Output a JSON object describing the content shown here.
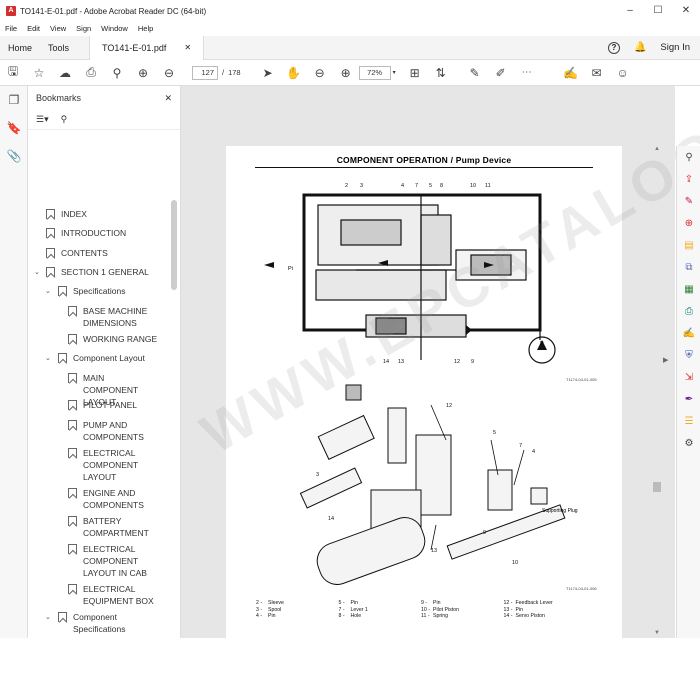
{
  "window": {
    "title": "TO141-E-01.pdf - Adobe Acrobat Reader DC (64-bit)",
    "controls": [
      "–",
      "☐",
      "✕"
    ]
  },
  "menu": [
    "File",
    "Edit",
    "View",
    "Sign",
    "Window",
    "Help"
  ],
  "tabs": {
    "home": "Home",
    "tools": "Tools",
    "doc": "TO141-E-01.pdf",
    "doc_close": "✕",
    "signin": "Sign In"
  },
  "toolbar": {
    "page_current": "127",
    "page_sep": "/",
    "page_total": "178",
    "zoom": "72%"
  },
  "bookmarks": {
    "title": "Bookmarks",
    "close": "✕",
    "items": [
      "INDEX",
      "INTRODUCTION",
      "CONTENTS",
      "SECTION 1 GENERAL",
      "Specifications",
      "BASE MACHINE DIMENSIONS",
      "WORKING RANGE",
      "Component Layout",
      "MAIN COMPONENT LAYOUT",
      "PILOT PANEL",
      "PUMP AND COMPONENTS",
      "ELECTRICAL COMPONENT LAYOUT",
      "ENGINE AND COMPONENTS",
      "BATTERY COMPARTMENT",
      "ELECTRICAL COMPONENT LAYOUT IN CAB",
      "ELECTRICAL EQUIPMENT BOX",
      "Component Specifications"
    ]
  },
  "page": {
    "title": "COMPONENT OPERATION / Pump Device",
    "watermark": "WWW.EPCATALOGS.COM",
    "caption_top": "T1174-04-01-005",
    "caption_bottom": "T1174-04-01-006",
    "label_pi": "Pi",
    "label_p": "P",
    "label_supporting_plug": "Supporting Plug",
    "legend": [
      [
        "2 -",
        "Sleeve",
        "5 -",
        "Pin",
        "9 -",
        "Pin",
        "12 -",
        "Feedback Lever"
      ],
      [
        "3 -",
        "Spool",
        "7 -",
        "Lever 1",
        "10 -",
        "Pilot Piston",
        "13 -",
        "Pin"
      ],
      [
        "4 -",
        "Pin",
        "8 -",
        "Hole",
        "11 -",
        "Spring",
        "14 -",
        "Servo Piston"
      ]
    ]
  },
  "right_tools": [
    "search-icon",
    "export-pdf-icon",
    "edit-pdf-icon",
    "create-pdf-icon",
    "comment-icon",
    "combine-icon",
    "organize-icon",
    "scan-icon",
    "fill-sign-icon",
    "protect-icon",
    "compress-icon",
    "sign-icon",
    "more-tools-icon",
    "settings-icon"
  ]
}
